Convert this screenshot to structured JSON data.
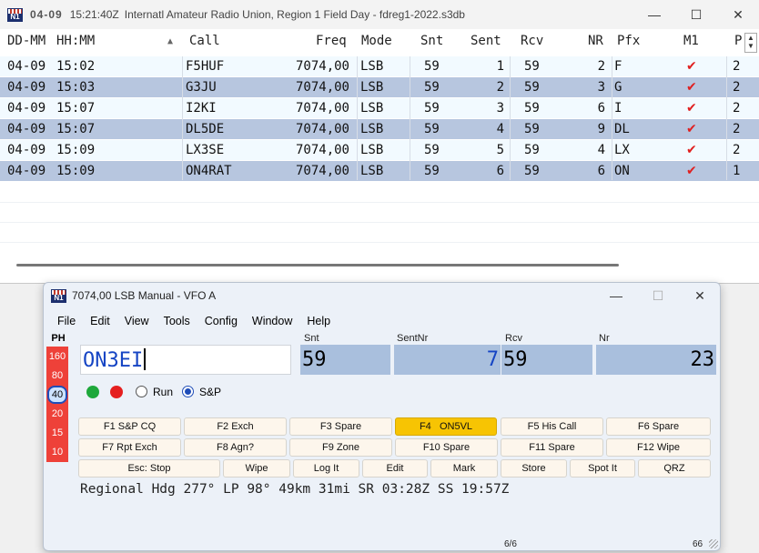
{
  "log_window": {
    "title_date": "04-09",
    "title_time": "15:21:40Z",
    "title_text": "Internatl Amateur Radio Union, Region 1 Field Day - fdreg1-2022.s3db",
    "columns": [
      "DD-MM",
      "HH:MM",
      "Call",
      "Freq",
      "Mode",
      "Snt",
      "Sent",
      "Rcv",
      "NR",
      "Pfx",
      "M1",
      "P"
    ],
    "rows": [
      {
        "date": "04-09",
        "time": "15:02",
        "call": "F5HUF",
        "freq": "7074,00",
        "mode": "LSB",
        "snt": "59",
        "sent": "1",
        "rcv": "59",
        "nr": "2",
        "pfx": "F",
        "m1": "check",
        "p": "2"
      },
      {
        "date": "04-09",
        "time": "15:03",
        "call": "G3JU",
        "freq": "7074,00",
        "mode": "LSB",
        "snt": "59",
        "sent": "2",
        "rcv": "59",
        "nr": "3",
        "pfx": "G",
        "m1": "check",
        "p": "2"
      },
      {
        "date": "04-09",
        "time": "15:07",
        "call": "I2KI",
        "freq": "7074,00",
        "mode": "LSB",
        "snt": "59",
        "sent": "3",
        "rcv": "59",
        "nr": "6",
        "pfx": "I",
        "m1": "check",
        "p": "2"
      },
      {
        "date": "04-09",
        "time": "15:07",
        "call": "DL5DE",
        "freq": "7074,00",
        "mode": "LSB",
        "snt": "59",
        "sent": "4",
        "rcv": "59",
        "nr": "9",
        "pfx": "DL",
        "m1": "check",
        "p": "2"
      },
      {
        "date": "04-09",
        "time": "15:09",
        "call": "LX3SE",
        "freq": "7074,00",
        "mode": "LSB",
        "snt": "59",
        "sent": "5",
        "rcv": "59",
        "nr": "4",
        "pfx": "LX",
        "m1": "check",
        "p": "2"
      },
      {
        "date": "04-09",
        "time": "15:09",
        "call": "ON4RAT",
        "freq": "7074,00",
        "mode": "LSB",
        "snt": "59",
        "sent": "6",
        "rcv": "59",
        "nr": "6",
        "pfx": "ON",
        "m1": "check",
        "p": "1"
      }
    ],
    "sorted_column": "HH:MM",
    "sort_direction": "ascending"
  },
  "entry_window": {
    "title": "7074,00 LSB Manual - VFO A",
    "menu": [
      "File",
      "Edit",
      "View",
      "Tools",
      "Config",
      "Window",
      "Help"
    ],
    "band_label": "PH",
    "bands": [
      "160",
      "80",
      "40",
      "20",
      "15",
      "10"
    ],
    "selected_band": "40",
    "call_value": "ON3EI",
    "field_labels": {
      "snt": "Snt",
      "sentnr": "SentNr",
      "rcv": "Rcv",
      "nr": "Nr"
    },
    "field_values": {
      "snt": "59",
      "sentnr": "7",
      "rcv": "59",
      "nr": "23"
    },
    "run_label": "Run",
    "sp_label": "S&P",
    "mode_selected": "S&P",
    "buttons_row1": [
      "F1 S&P CQ",
      "F2 Exch",
      "F3 Spare",
      "F4   ON5VL",
      "F5 His Call",
      "F6 Spare"
    ],
    "buttons_row2": [
      "F7 Rpt Exch",
      "F8 Agn?",
      "F9 Zone",
      "F10 Spare",
      "F11 Spare",
      "F12 Wipe"
    ],
    "buttons_row3": [
      "Esc: Stop",
      "Wipe",
      "Log It",
      "Edit",
      "Mark",
      "Store",
      "Spot It",
      "QRZ"
    ],
    "status_text": "Regional Hdg 277° LP 98° 49km 31mi SR 03:28Z SS 19:57Z",
    "page_indicator": "6/6",
    "count_indicator": "66",
    "colors": {
      "band_red": "#ee4139",
      "highlight_button": "#f7c403",
      "call_text": "#1645c4",
      "row_alt": "#b7c6df"
    }
  }
}
